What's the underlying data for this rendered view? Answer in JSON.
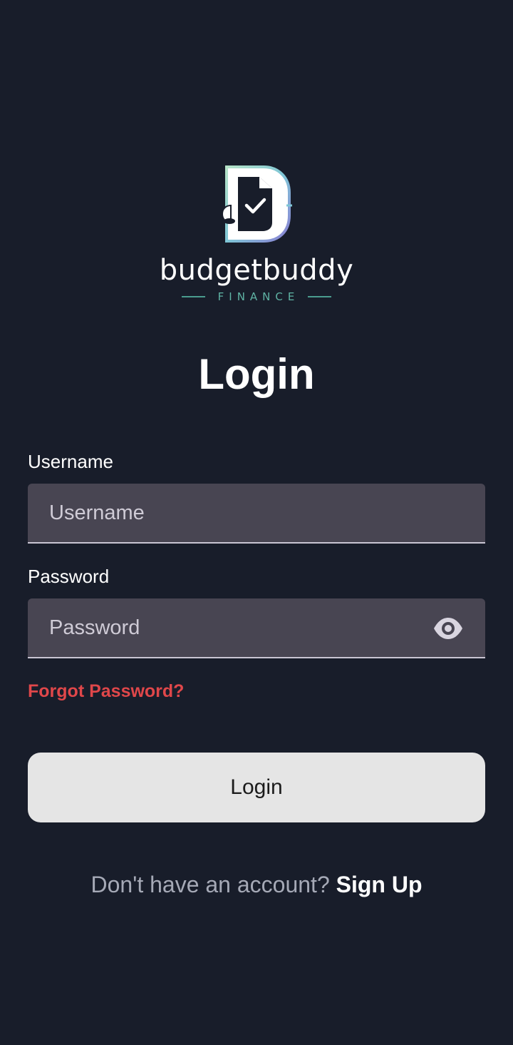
{
  "brand": {
    "name": "budgetbuddy",
    "subtitle": "FINANCE",
    "logo_icon": "budgetbuddy-logo-icon"
  },
  "title": "Login",
  "form": {
    "username": {
      "label": "Username",
      "placeholder": "Username",
      "value": ""
    },
    "password": {
      "label": "Password",
      "placeholder": "Password",
      "value": "",
      "toggle_icon": "eye-icon"
    },
    "forgot_label": "Forgot Password?",
    "submit_label": "Login"
  },
  "footer": {
    "prompt": "Don't have an account?",
    "signup_label": "Sign Up"
  },
  "colors": {
    "background": "#181d2a",
    "input_bg": "#484552",
    "accent_red": "#e0474a",
    "brand_teal": "#5fb3a4",
    "button_bg": "#e5e5e5"
  }
}
